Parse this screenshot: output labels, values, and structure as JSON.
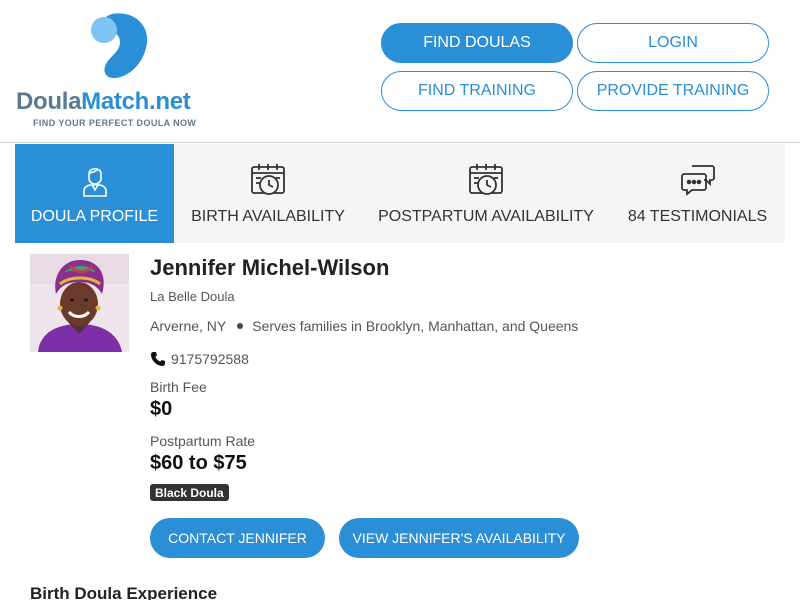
{
  "colors": {
    "brand_blue": "#2a8fd6",
    "brand_slate": "#5b7a93",
    "tab_bg": "#f5f5f5",
    "badge_bg": "#333333"
  },
  "logo": {
    "word_doula": "Doula",
    "word_match": "Match.net",
    "tagline": "FIND YOUR PERFECT DOULA NOW"
  },
  "nav": {
    "find_doulas": "FIND DOULAS",
    "login": "LOGIN",
    "find_training": "FIND TRAINING",
    "provide_training": "PROVIDE TRAINING"
  },
  "tabs": [
    {
      "label": "DOULA PROFILE",
      "icon": "doula-person-icon",
      "active": true
    },
    {
      "label": "BIRTH AVAILABILITY",
      "icon": "calendar-clock-icon",
      "active": false
    },
    {
      "label": "POSTPARTUM AVAILABILITY",
      "icon": "calendar-clock-icon",
      "active": false
    },
    {
      "label": "84 TESTIMONIALS",
      "icon": "chat-bubbles-icon",
      "active": false
    }
  ],
  "profile": {
    "name": "Jennifer Michel-Wilson",
    "business": "La Belle Doula",
    "city": "Arverne, NY",
    "serves": "Serves families in Brooklyn, Manhattan, and Queens",
    "phone": "9175792588",
    "birth_fee_label": "Birth Fee",
    "birth_fee": "$0",
    "postpartum_rate_label": "Postpartum Rate",
    "postpartum_rate": "$60 to $75",
    "badge": "Black Doula",
    "contact_button": "CONTACT JENNIFER",
    "availability_button": "VIEW JENNIFER'S AVAILABILITY"
  },
  "sections": {
    "birth_experience_heading": "Birth Doula Experience"
  }
}
